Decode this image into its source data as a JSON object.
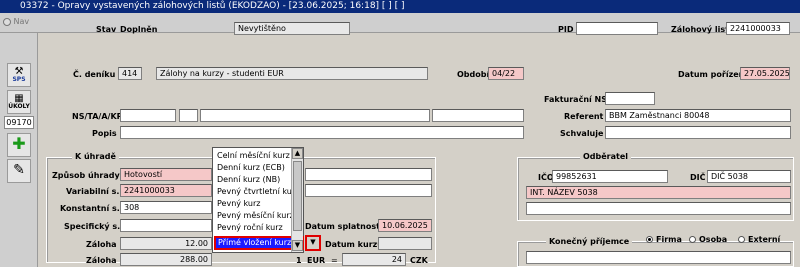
{
  "window": {
    "title": "03372 - Opravy vystavených zálohových listů (EKODZAO) - [23.06.2025; 16:18] [ ] [ ]",
    "app_icon": "F"
  },
  "toolbar": {
    "nav_label": "Nav"
  },
  "sidebar": {
    "sps_label": "SPS",
    "ukoly_label": "ÚKOLY",
    "counter": "09170"
  },
  "header": {
    "stav_label": "Stav",
    "stav_value": "Doplněn",
    "stav_field": "Nevytištěno",
    "pid_label": "PID",
    "pid_value": "",
    "zal_list_label": "Zálohový list",
    "zal_list_value": "2241000033",
    "cdeniku_label": "Č. deníku",
    "cdeniku_code": "414",
    "cdeniku_name": "Zálohy na kurzy - studenti EUR",
    "obdobi_label": "Období",
    "obdobi_value": "04/22",
    "datum_poriz_label": "Datum pořízení",
    "datum_poriz_value": "27.05.2025",
    "fakt_ns_label": "Fakturační NS",
    "nsta_label": "NS/TA/A/KP",
    "referent_label": "Referent",
    "referent_value": "BBM Zaměstnanci 80048",
    "popis_label": "Popis",
    "schvaluje_label": "Schvaluje"
  },
  "uhrada": {
    "group_title": "K úhradě",
    "zpusob_label": "Způsob úhrady",
    "zpusob_value": "Hotovostí",
    "var_label": "Variabilní s.",
    "var_value": "2241000033",
    "konst_label": "Konstantní s.",
    "konst_value": "308",
    "spec_label": "Specifický s.",
    "zaloha_label": "Záloha",
    "zaloha_value": "12.00",
    "zaloha2_label": "Záloha",
    "zaloha2_value": "288.00",
    "splatnost_label": "Datum splatnosti",
    "splatnost_value": "10.06.2025",
    "datum_kurzu_label": "Datum kurzu",
    "kurz_qty": "1",
    "currency_from": "EUR",
    "equals": "=",
    "rate": "24",
    "currency_to": "CZK"
  },
  "kurz_dropdown": {
    "items": [
      "Celní měsíční kurz",
      "Denní kurz (ECB)",
      "Denní kurz (NB)",
      "Pevný čtvrtletní kurz",
      "Pevný kurz",
      "Pevný měsíční kurz",
      "Pevný roční kurz"
    ],
    "selected": "Přímé vložení kurzu"
  },
  "odberatel": {
    "group_title": "Odběratel",
    "ico_label": "IČO",
    "ico_value": "99852631",
    "dic_label": "DIČ",
    "dic_value": "DIČ 5038",
    "name_value": "INT. NÁZEV 5038"
  },
  "prijemce": {
    "label": "Konečný příjemce",
    "options": [
      "Firma",
      "Osoba",
      "Externí"
    ],
    "selected": "Firma"
  }
}
